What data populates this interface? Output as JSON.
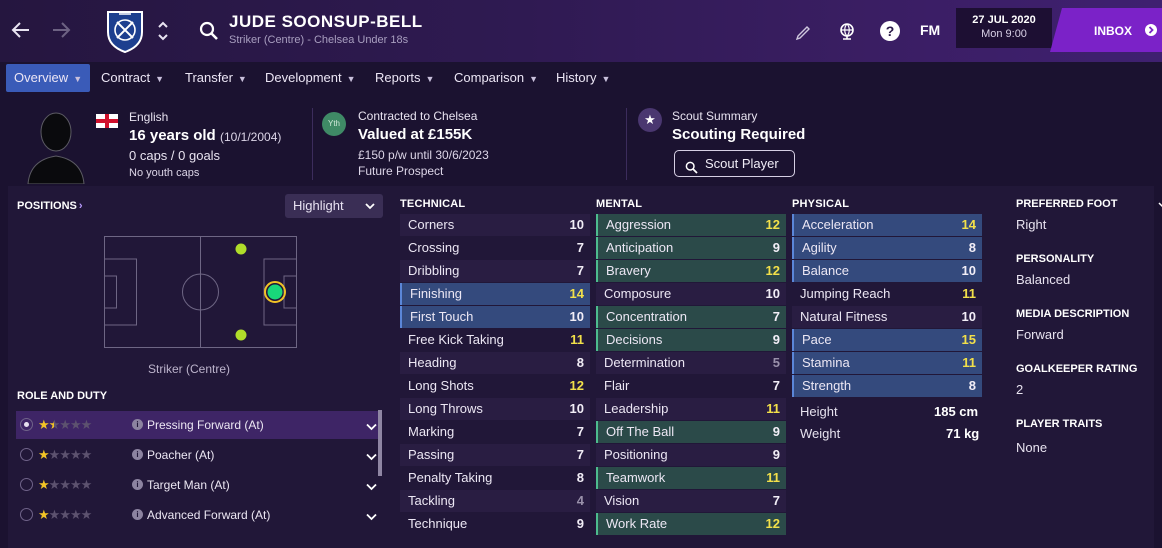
{
  "header": {
    "player_name": "JUDE SOONSUP-BELL",
    "player_sub": "Striker (Centre) - Chelsea Under 18s",
    "brand": "FM",
    "date_main": "27 JUL 2020",
    "date_sub": "Mon 9:00",
    "inbox_label": "INBOX"
  },
  "icons": {
    "back": "arrow-left-icon",
    "forward": "arrow-right-icon",
    "club": "club-crest-icon",
    "swap": "chevron-up-down-icon",
    "search": "search-icon",
    "edit": "pencil-icon",
    "globe": "globe-icon",
    "help": "help-icon"
  },
  "tabs": [
    {
      "label": "Overview"
    },
    {
      "label": "Contract"
    },
    {
      "label": "Transfer"
    },
    {
      "label": "Development"
    },
    {
      "label": "Reports"
    },
    {
      "label": "Comparison"
    },
    {
      "label": "History"
    }
  ],
  "info": {
    "nationality": "English",
    "age": "16 years old",
    "dob": "(10/1/2004)",
    "caps": "0 caps / 0 goals",
    "youth_caps": "No youth caps",
    "contract_label": "Contracted to Chelsea",
    "valued": "Valued at £155K",
    "wage": "£150 p/w until 30/6/2023",
    "prospect": "Future Prospect",
    "youth_badge": "Yth",
    "scout_label": "Scout Summary",
    "scout_status": "Scouting Required",
    "scout_button": "Scout Player"
  },
  "positions": {
    "title": "POSITIONS",
    "highlight": "Highlight",
    "position_label": "Striker (Centre)"
  },
  "roles": {
    "title": "ROLE AND DUTY",
    "items": [
      {
        "name": "Pressing Forward (At)",
        "stars": 1.5,
        "selected": true
      },
      {
        "name": "Poacher (At)",
        "stars": 1,
        "selected": false
      },
      {
        "name": "Target Man (At)",
        "stars": 1,
        "selected": false
      },
      {
        "name": "Advanced Forward (At)",
        "stars": 1,
        "selected": false
      }
    ]
  },
  "technical": {
    "title": "TECHNICAL",
    "attrs": [
      {
        "name": "Corners",
        "value": "10"
      },
      {
        "name": "Crossing",
        "value": "7"
      },
      {
        "name": "Dribbling",
        "value": "7"
      },
      {
        "name": "Finishing",
        "value": "14"
      },
      {
        "name": "First Touch",
        "value": "10"
      },
      {
        "name": "Free Kick Taking",
        "value": "11"
      },
      {
        "name": "Heading",
        "value": "8"
      },
      {
        "name": "Long Shots",
        "value": "12"
      },
      {
        "name": "Long Throws",
        "value": "10"
      },
      {
        "name": "Marking",
        "value": "7"
      },
      {
        "name": "Passing",
        "value": "7"
      },
      {
        "name": "Penalty Taking",
        "value": "8"
      },
      {
        "name": "Tackling",
        "value": "4"
      },
      {
        "name": "Technique",
        "value": "9"
      }
    ]
  },
  "mental": {
    "title": "MENTAL",
    "attrs": [
      {
        "name": "Aggression",
        "value": "12"
      },
      {
        "name": "Anticipation",
        "value": "9"
      },
      {
        "name": "Bravery",
        "value": "12"
      },
      {
        "name": "Composure",
        "value": "10"
      },
      {
        "name": "Concentration",
        "value": "7"
      },
      {
        "name": "Decisions",
        "value": "9"
      },
      {
        "name": "Determination",
        "value": "5"
      },
      {
        "name": "Flair",
        "value": "7"
      },
      {
        "name": "Leadership",
        "value": "11"
      },
      {
        "name": "Off The Ball",
        "value": "9"
      },
      {
        "name": "Positioning",
        "value": "9"
      },
      {
        "name": "Teamwork",
        "value": "11"
      },
      {
        "name": "Vision",
        "value": "7"
      },
      {
        "name": "Work Rate",
        "value": "12"
      }
    ]
  },
  "physical": {
    "title": "PHYSICAL",
    "attrs": [
      {
        "name": "Acceleration",
        "value": "14"
      },
      {
        "name": "Agility",
        "value": "8"
      },
      {
        "name": "Balance",
        "value": "10"
      },
      {
        "name": "Jumping Reach",
        "value": "11"
      },
      {
        "name": "Natural Fitness",
        "value": "10"
      },
      {
        "name": "Pace",
        "value": "15"
      },
      {
        "name": "Stamina",
        "value": "11"
      },
      {
        "name": "Strength",
        "value": "8"
      }
    ],
    "height_label": "Height",
    "height_value": "185 cm",
    "weight_label": "Weight",
    "weight_value": "71 kg"
  },
  "details": {
    "preferred_foot_title": "PREFERRED FOOT",
    "preferred_foot": "Right",
    "personality_title": "PERSONALITY",
    "personality": "Balanced",
    "media_title": "MEDIA DESCRIPTION",
    "media": "Forward",
    "gk_title": "GOALKEEPER RATING",
    "gk": "2",
    "traits_title": "PLAYER TRAITS",
    "traits": "None"
  }
}
